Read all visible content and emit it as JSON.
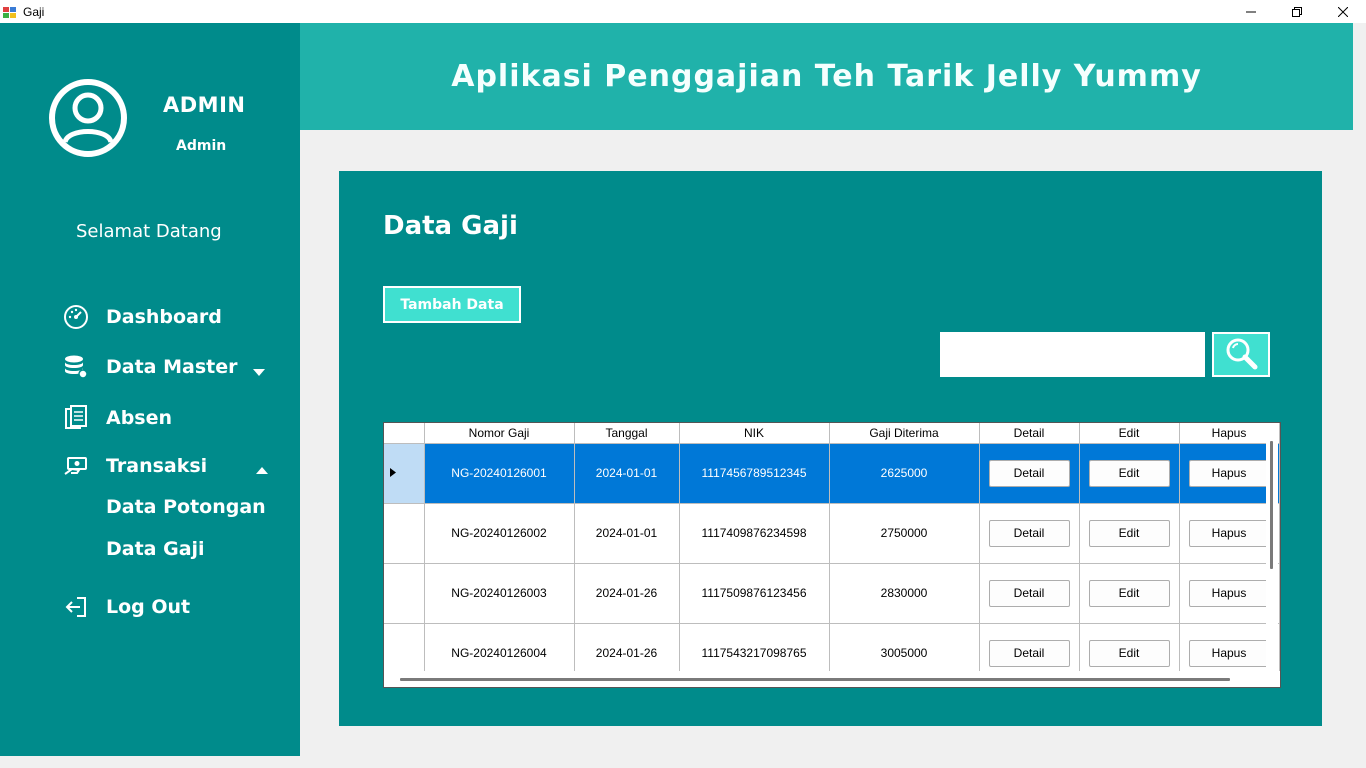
{
  "window": {
    "title": "Gaji"
  },
  "sidebar": {
    "user_name": "ADMIN",
    "user_role": "Admin",
    "welcome": "Selamat Datang",
    "nav": {
      "dashboard": "Dashboard",
      "data_master": "Data Master",
      "absen": "Absen",
      "transaksi": "Transaksi",
      "data_potongan": "Data Potongan",
      "data_gaji": "Data Gaji",
      "logout": "Log Out"
    }
  },
  "header": {
    "title": "Aplikasi Penggajian Teh Tarik Jelly Yummy"
  },
  "main": {
    "title": "Data Gaji",
    "add_button": "Tambah Data",
    "search": {
      "value": "",
      "placeholder": ""
    }
  },
  "grid": {
    "columns": [
      "Nomor Gaji",
      "Tanggal",
      "NIK",
      "Gaji Diterima",
      "Detail",
      "Edit",
      "Hapus"
    ],
    "rows": [
      {
        "nomor": "NG-20240126001",
        "tanggal": "2024-01-01",
        "nik": "1117456789512345",
        "gaji": "2625000",
        "detail": "Detail",
        "edit": "Edit",
        "hapus": "Hapus"
      },
      {
        "nomor": "NG-20240126002",
        "tanggal": "2024-01-01",
        "nik": "1117409876234598",
        "gaji": "2750000",
        "detail": "Detail",
        "edit": "Edit",
        "hapus": "Hapus"
      },
      {
        "nomor": "NG-20240126003",
        "tanggal": "2024-01-26",
        "nik": "1117509876123456",
        "gaji": "2830000",
        "detail": "Detail",
        "edit": "Edit",
        "hapus": "Hapus"
      },
      {
        "nomor": "NG-20240126004",
        "tanggal": "2024-01-26",
        "nik": "1117543217098765",
        "gaji": "3005000",
        "detail": "Detail",
        "edit": "Edit",
        "hapus": "Hapus"
      }
    ]
  },
  "colors": {
    "sidebar": "#008b8b",
    "header": "#20b2aa",
    "accent": "#40e0d0",
    "selection": "#0078d7"
  }
}
